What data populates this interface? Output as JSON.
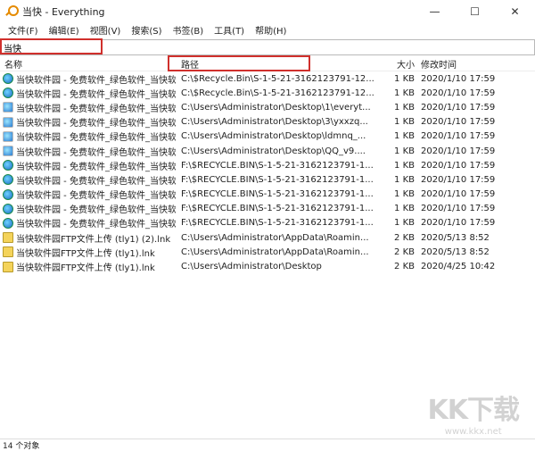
{
  "window": {
    "title": "当快 - Everything",
    "minimize": "—",
    "maximize": "☐",
    "close": "✕"
  },
  "menu": [
    "文件(F)",
    "编辑(E)",
    "视图(V)",
    "搜索(S)",
    "书签(B)",
    "工具(T)",
    "帮助(H)"
  ],
  "search": {
    "value": "当快"
  },
  "columns": {
    "name": "名称",
    "path": "路径",
    "size": "大小",
    "date": "修改时间"
  },
  "rows": [
    {
      "icon": "globe",
      "name": "当快软件园 - 免费软件_绿色软件_当快软...",
      "path": "C:\\$Recycle.Bin\\S-1-5-21-3162123791-12...",
      "size": "1 KB",
      "date": "2020/1/10 17:59"
    },
    {
      "icon": "globe",
      "name": "当快软件园 - 免费软件_绿色软件_当快软...",
      "path": "C:\\$Recycle.Bin\\S-1-5-21-3162123791-12...",
      "size": "1 KB",
      "date": "2020/1/10 17:59"
    },
    {
      "icon": "ie",
      "name": "当快软件园 - 免费软件_绿色软件_当快软...",
      "path": "C:\\Users\\Administrator\\Desktop\\1\\everyt...",
      "size": "1 KB",
      "date": "2020/1/10 17:59"
    },
    {
      "icon": "ie",
      "name": "当快软件园 - 免费软件_绿色软件_当快软...",
      "path": "C:\\Users\\Administrator\\Desktop\\3\\yxxzq...",
      "size": "1 KB",
      "date": "2020/1/10 17:59"
    },
    {
      "icon": "ie",
      "name": "当快软件园 - 免费软件_绿色软件_当快软...",
      "path": "C:\\Users\\Administrator\\Desktop\\ldmnq_...",
      "size": "1 KB",
      "date": "2020/1/10 17:59"
    },
    {
      "icon": "ie",
      "name": "当快软件园 - 免费软件_绿色软件_当快软...",
      "path": "C:\\Users\\Administrator\\Desktop\\QQ_v9....",
      "size": "1 KB",
      "date": "2020/1/10 17:59"
    },
    {
      "icon": "globe",
      "name": "当快软件园 - 免费软件_绿色软件_当快软...",
      "path": "F:\\$RECYCLE.BIN\\S-1-5-21-3162123791-1...",
      "size": "1 KB",
      "date": "2020/1/10 17:59"
    },
    {
      "icon": "globe",
      "name": "当快软件园 - 免费软件_绿色软件_当快软...",
      "path": "F:\\$RECYCLE.BIN\\S-1-5-21-3162123791-1...",
      "size": "1 KB",
      "date": "2020/1/10 17:59"
    },
    {
      "icon": "globe",
      "name": "当快软件园 - 免费软件_绿色软件_当快软...",
      "path": "F:\\$RECYCLE.BIN\\S-1-5-21-3162123791-1...",
      "size": "1 KB",
      "date": "2020/1/10 17:59"
    },
    {
      "icon": "globe",
      "name": "当快软件园 - 免费软件_绿色软件_当快软...",
      "path": "F:\\$RECYCLE.BIN\\S-1-5-21-3162123791-1...",
      "size": "1 KB",
      "date": "2020/1/10 17:59"
    },
    {
      "icon": "globe",
      "name": "当快软件园 - 免费软件_绿色软件_当快软...",
      "path": "F:\\$RECYCLE.BIN\\S-1-5-21-3162123791-1...",
      "size": "1 KB",
      "date": "2020/1/10 17:59"
    },
    {
      "icon": "lnk",
      "name": "当快软件园FTP文件上传 (tly1) (2).lnk",
      "path": "C:\\Users\\Administrator\\AppData\\Roamin...",
      "size": "2 KB",
      "date": "2020/5/13 8:52"
    },
    {
      "icon": "lnk",
      "name": "当快软件园FTP文件上传 (tly1).lnk",
      "path": "C:\\Users\\Administrator\\AppData\\Roamin...",
      "size": "2 KB",
      "date": "2020/5/13 8:52"
    },
    {
      "icon": "lnk",
      "name": "当快软件园FTP文件上传 (tly1).lnk",
      "path": "C:\\Users\\Administrator\\Desktop",
      "size": "2 KB",
      "date": "2020/4/25 10:42"
    }
  ],
  "status": "14 个对象",
  "watermark": {
    "big": "KK下载",
    "small": "www.kkx.net"
  },
  "colors": {
    "highlight": "#d0302c"
  }
}
